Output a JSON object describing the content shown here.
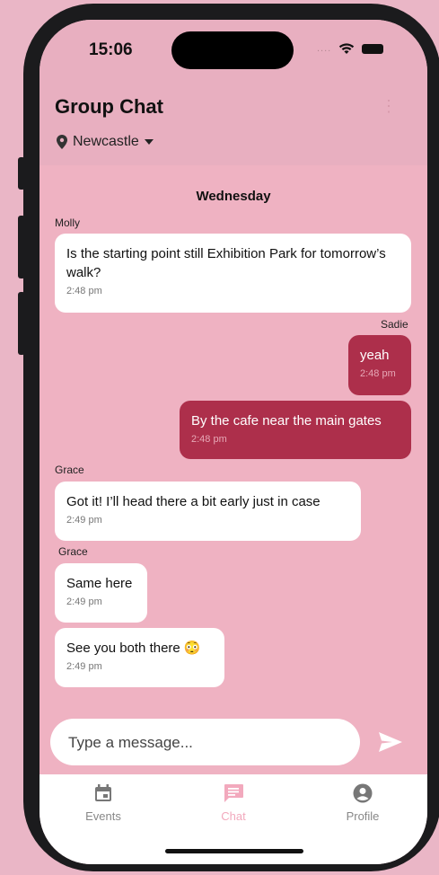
{
  "status_bar": {
    "time": "15:06",
    "signal_dots": "....",
    "wifi_icon": "wifi-icon",
    "battery_icon": "battery-icon"
  },
  "header": {
    "title": "Group Chat",
    "location": "Newcastle"
  },
  "chat": {
    "day": "Wednesday",
    "messages": [
      {
        "sender": "Molly",
        "text": "Is the starting point still Exhibition Park for tomorrow’s walk?",
        "time": "2:48 pm",
        "direction": "in"
      },
      {
        "sender": "Sadie",
        "text": "yeah",
        "time": "2:48 pm",
        "direction": "out"
      },
      {
        "sender": "",
        "text": "By the cafe near the main gates",
        "time": "2:48 pm",
        "direction": "out"
      },
      {
        "sender": "Grace",
        "text": "Got it! I’ll head there a bit early just in case",
        "time": "2:49 pm",
        "direction": "in"
      },
      {
        "sender": "Grace",
        "text": "Same here",
        "time": "2:49 pm",
        "direction": "in"
      },
      {
        "sender": "",
        "text": "See you both there 😳",
        "time": "2:49 pm",
        "direction": "in"
      }
    ]
  },
  "composer": {
    "placeholder": "Type a message..."
  },
  "nav": {
    "items": [
      {
        "label": "Events",
        "icon": "calendar-icon"
      },
      {
        "label": "Chat",
        "icon": "chat-icon",
        "active": true
      },
      {
        "label": "Profile",
        "icon": "profile-icon"
      }
    ]
  },
  "colors": {
    "background": "#efb2c2",
    "outgoing_bubble": "#ad2f4b",
    "active_tab": "#f2a9bd"
  }
}
